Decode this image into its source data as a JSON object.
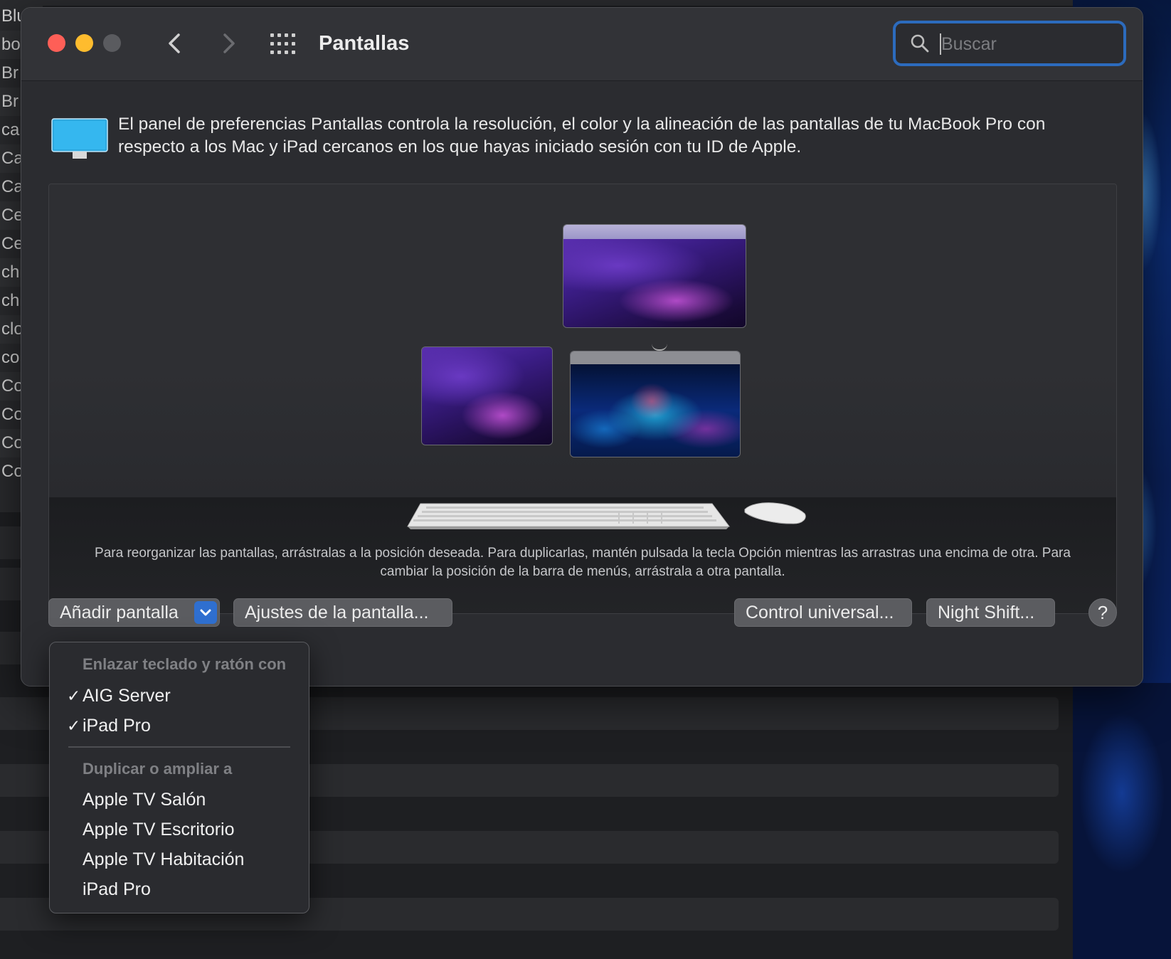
{
  "background_app": {
    "rows": [
      "Blu",
      "bo",
      "Br",
      "Br",
      "ca",
      "Ca",
      "Ca",
      "Ce",
      "Ce",
      "ch",
      "ch",
      "clo",
      "co",
      "Co",
      "Co",
      "Co",
      "Co"
    ]
  },
  "window": {
    "title": "Pantallas",
    "search": {
      "placeholder": "Buscar",
      "value": ""
    },
    "description": "El panel de preferencias Pantallas controla la resolución, el color y la alineación de las pantallas de tu MacBook Pro con respecto a los Mac y iPad cercanos en los que hayas iniciado sesión con tu ID de Apple.",
    "arrangement_hint": "Para reorganizar las pantallas, arrástralas a la posición deseada. Para duplicarlas, mantén pulsada la tecla Opción mientras las arrastras una encima de otra. Para cambiar la posición de la barra de menús, arrástrala a otra pantalla.",
    "buttons": {
      "add_display": "Añadir pantalla",
      "display_settings": "Ajustes de la pantalla...",
      "universal_control": "Control universal...",
      "night_shift": "Night Shift...",
      "help": "?"
    }
  },
  "menu": {
    "section1_header": "Enlazar teclado y ratón con",
    "section1_items": [
      {
        "label": "AIG Server",
        "checked": true
      },
      {
        "label": "iPad Pro",
        "checked": true
      }
    ],
    "section2_header": "Duplicar o ampliar a",
    "section2_items": [
      {
        "label": "Apple TV Salón"
      },
      {
        "label": "Apple TV Escritorio"
      },
      {
        "label": "Apple TV Habitación"
      },
      {
        "label": "iPad Pro"
      }
    ],
    "check_glyph": "✓"
  },
  "colors": {
    "close": "#fe5f57",
    "minimize": "#febc2e",
    "zoom_disabled": "#5a5b5f",
    "accent": "#2f6fd0",
    "search_focus": "#2c6bbd"
  },
  "icons": [
    "search-icon",
    "chevron-left-icon",
    "chevron-right-icon",
    "grid-icon",
    "display-icon",
    "chevron-down-icon",
    "keyboard-icon",
    "mouse-icon"
  ]
}
